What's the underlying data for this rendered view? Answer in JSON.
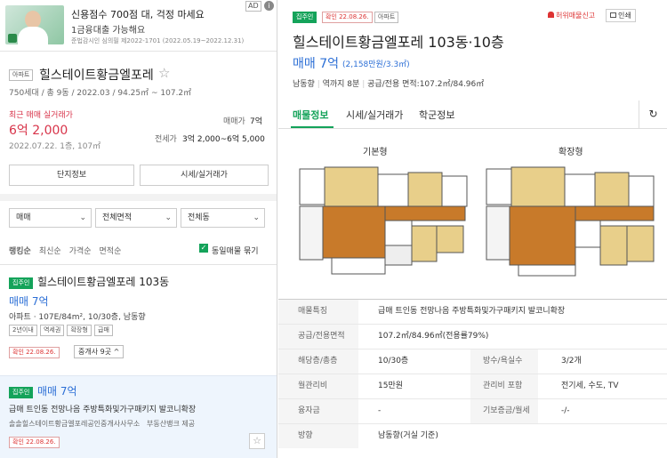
{
  "ad": {
    "title": "신용점수 700점 대, 걱정 마세요",
    "subtitle": "1금융대출 가능해요",
    "note": "준법감시인 심의필 제2022-1701 (2022.05.19~2022.12.31)",
    "badge": "AD",
    "info": "i"
  },
  "complex": {
    "type_tag": "아파트",
    "name": "힐스테이트황금엘포레",
    "star": "☆",
    "info": "750세대 / 총 9동 / 2022.03 / 94.25㎡ ~ 107.2㎡",
    "recent_label": "최근 매매 실거래가",
    "recent_price": "6억 2,000",
    "recent_date": "2022.07.22. 1층, 107㎡",
    "sale_label": "매매가",
    "sale_value": "7억",
    "jeonse_label": "전세가",
    "jeonse_value": "3억 2,000~6억 5,000",
    "btn_info": "단지정보",
    "btn_price": "시세/실거래가"
  },
  "filters": {
    "trade": "매매",
    "area": "전체면적",
    "dong": "전체동",
    "caret": "⌄"
  },
  "sort": {
    "items": [
      "랭킹순",
      "최신순",
      "가격순",
      "면적순"
    ],
    "group_label": "동일매물 묶기",
    "check": "✓"
  },
  "listing1": {
    "tag": "집주인",
    "name": "힐스테이트황금엘포레 103동",
    "price": "매매 7억",
    "spec": "아파트 · 107E/84m², 10/30층, 남동향",
    "chips": [
      "2년이내",
      "역세권",
      "확장형",
      "급매"
    ],
    "confirm": "확인 22.08.26.",
    "agents": "중개사 9곳",
    "chevron": "^"
  },
  "listing2": {
    "tag": "집주인",
    "price": "매매 7억",
    "desc": "급매 트인동 전망나음 주방특화및가구패키지 발코니확장",
    "agency": "솔솔힐스테이트황금엘포레공인중개사사무소",
    "provider": "부동산뱅크 제공",
    "confirm": "확인 22.08.26.",
    "star": "☆"
  },
  "detail": {
    "owner_tag": "집주인",
    "confirm": "확인 22.08.26.",
    "type_tag": "아파트",
    "report": "허위매물신고",
    "print": "인쇄",
    "title": "힐스테이트황금엘포레 103동·10층",
    "price": "매매 7억",
    "price_unit": "(2,158만원/3.3㎡)",
    "meta": [
      "남동향",
      "역까지 8분",
      "공급/전용 면적:107.2㎡/84.96㎡"
    ],
    "tabs": [
      "매물정보",
      "시세/실거래가",
      "학군정보"
    ],
    "refresh": "↻",
    "fp_basic": "기본형",
    "fp_ext": "확장형"
  },
  "table": {
    "rows": [
      {
        "k": "매물특징",
        "v": "급매 트인동 전망나음 주방특화및가구패키지 발코니확장"
      },
      {
        "k": "공급/전용면적",
        "v": "107.2㎡/84.96㎡(전용률79%)"
      },
      {
        "k": "해당층/총층",
        "v": "10/30층",
        "k2": "방수/욕실수",
        "v2": "3/2개"
      },
      {
        "k": "월관리비",
        "v": "15만원",
        "k2": "관리비 포함",
        "v2": "전기세, 수도, TV"
      },
      {
        "k": "융자금",
        "v": "-",
        "k2": "기보증금/월세",
        "v2": "-/-"
      },
      {
        "k": "방향",
        "v": "남동향(거실 기준)"
      }
    ]
  }
}
